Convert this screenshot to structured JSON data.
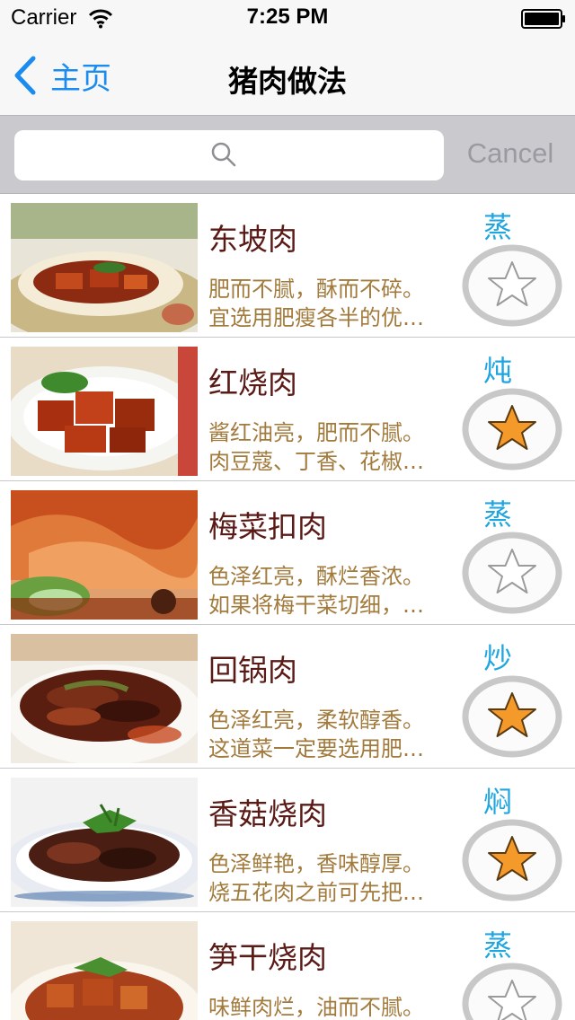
{
  "status_bar": {
    "carrier": "Carrier",
    "time": "7:25 PM"
  },
  "nav": {
    "back_label": "主页",
    "title": "猪肉做法"
  },
  "search": {
    "placeholder": "",
    "cancel_label": "Cancel"
  },
  "colors": {
    "accent": "#1a8cf0",
    "method": "#1fa6e0",
    "dish_name": "#5a1a16",
    "description": "#a27a3c",
    "star_on": "#f49a2a",
    "star_off": "#ffffff"
  },
  "recipes": [
    {
      "name": "东坡肉",
      "desc1": "肥而不腻，酥而不碎。",
      "desc2": "宜选用肥瘦各半的优…",
      "method": "蒸",
      "favorited": false
    },
    {
      "name": "红烧肉",
      "desc1": "酱红油亮，肥而不腻。",
      "desc2": "肉豆蔻、丁香、花椒…",
      "method": "炖",
      "favorited": true
    },
    {
      "name": "梅菜扣肉",
      "desc1": "色泽红亮，酥烂香浓。",
      "desc2": "如果将梅干菜切细，…",
      "method": "蒸",
      "favorited": false
    },
    {
      "name": "回锅肉",
      "desc1": "色泽红亮，柔软醇香。",
      "desc2": "这道菜一定要选用肥…",
      "method": "炒",
      "favorited": true
    },
    {
      "name": "香菇烧肉",
      "desc1": "色泽鲜艳，香味醇厚。",
      "desc2": "烧五花肉之前可先把…",
      "method": "焖",
      "favorited": true
    },
    {
      "name": "笋干烧肉",
      "desc1": "味鲜肉烂，油而不腻。",
      "desc2": "",
      "method": "蒸",
      "favorited": false
    }
  ]
}
